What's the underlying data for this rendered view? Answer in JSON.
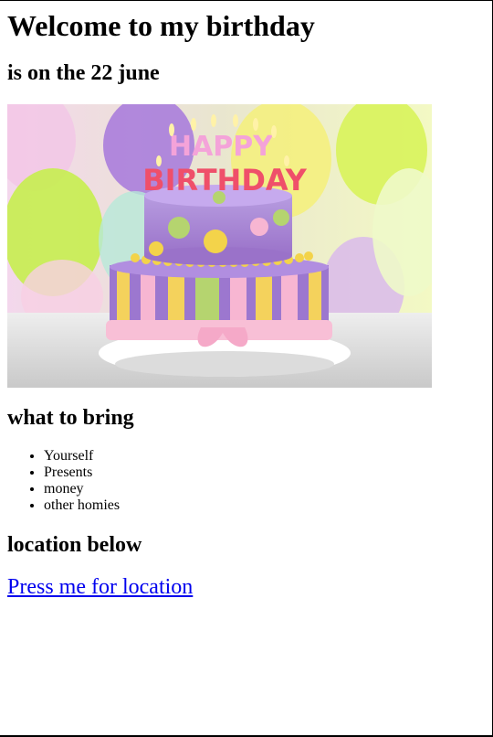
{
  "heading": "Welcome to my birthday",
  "date": "is on the 22 june",
  "image": {
    "banner_top": "HAPPY",
    "banner_bottom": "BIRTHDAY"
  },
  "bring": {
    "title": "what to bring",
    "items": [
      "Yourself",
      "Presents",
      "money",
      "other homies"
    ]
  },
  "location": {
    "title": "location below",
    "link_text": "Press me for location"
  },
  "colors": {
    "link": "#0000ee",
    "text": "#000000"
  }
}
